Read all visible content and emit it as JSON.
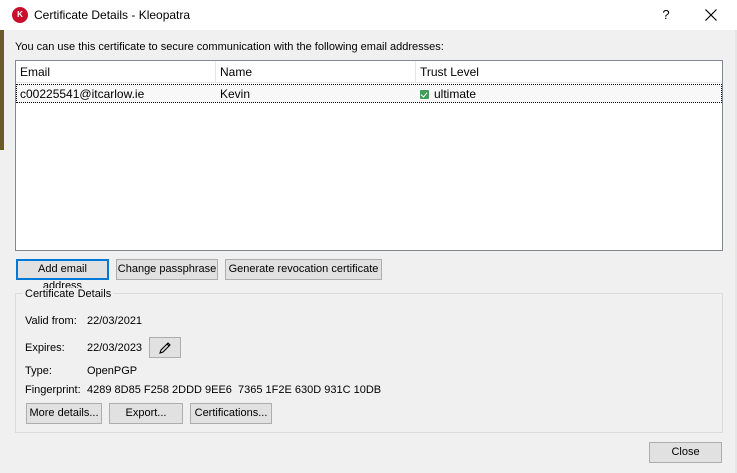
{
  "window": {
    "title": "Certificate Details - Kleopatra",
    "help_label": "?"
  },
  "intro_text": "You can use this certificate to secure communication with the following email addresses:",
  "table": {
    "columns": [
      "Email",
      "Name",
      "Trust Level"
    ],
    "rows": [
      {
        "email": "c00225541@itcarlow.ie",
        "name": "Kevin",
        "trust": "ultimate"
      }
    ]
  },
  "actions": {
    "add_email": "Add email address",
    "change_passphrase": "Change passphrase",
    "generate_revocation": "Generate revocation certificate"
  },
  "details": {
    "group_title": "Certificate Details",
    "valid_from_label": "Valid from:",
    "valid_from_value": "22/03/2021",
    "expires_label": "Expires:",
    "expires_value": "22/03/2023",
    "type_label": "Type:",
    "type_value": "OpenPGP",
    "fingerprint_label": "Fingerprint:",
    "fingerprint_value": "4289 8D85 F258 2DDD 9EE6  7365 1F2E 630D 931C 10DB",
    "more_details": "More details...",
    "export": "Export...",
    "certifications": "Certifications..."
  },
  "footer": {
    "close": "Close"
  },
  "colors": {
    "focus_border": "#0078d7",
    "trust_ok": "#3f9e5a",
    "app_icon": "#c8102e"
  }
}
